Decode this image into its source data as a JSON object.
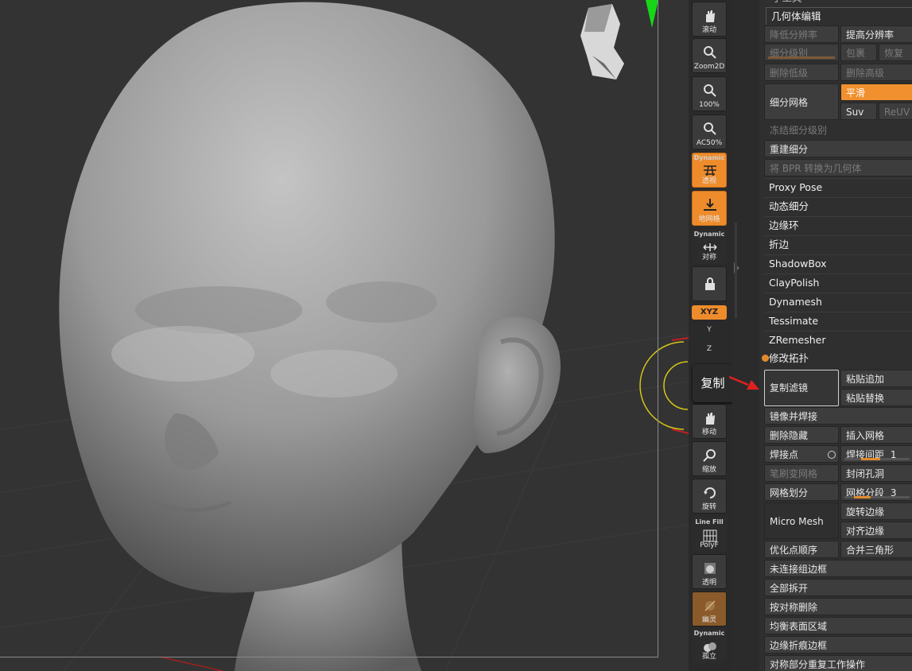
{
  "toolbar": {
    "scroll": "滚动",
    "zoom2d": "Zoom2D",
    "zoom100": "100%",
    "ac50": "AC50%",
    "persp_top": "Dynamic",
    "persp": "透视",
    "floor": "地网格",
    "sym_top": "Dynamic",
    "sym": "对称",
    "xyz": "XYZ",
    "y_glyph": "Y",
    "z_glyph": "Z",
    "move": "移动",
    "scale": "缩放",
    "rotate": "旋转",
    "linefill_top": "Line Fill",
    "polyf": "PolyF",
    "transp": "透明",
    "ghost": "幽灵",
    "solo_top": "Dynamic",
    "solo": "孤立"
  },
  "popup": {
    "label": "复制"
  },
  "panel": {
    "top_cut": "子工具",
    "geometry_title": "几何体编辑",
    "lower_res": "降低分辨率",
    "higher_res": "提高分辨率",
    "sdiv": "细分级别",
    "cage": "包裹",
    "restore": "恢复",
    "del_lower": "删除低级",
    "del_higher": "删除高级",
    "divide": "细分网格",
    "smooth": "平滑",
    "suv": "Suv",
    "reuv": "ReUV",
    "freeze": "冻结细分级别",
    "reconstruct": "重建细分",
    "bpr": "将 BPR 转换为几何体",
    "proxy": "Proxy Pose",
    "dynamic_sub": "动态细分",
    "edgeloop": "边缘环",
    "crease": "折边",
    "shadowbox": "ShadowBox",
    "claypolish": "ClayPolish",
    "dynamesh": "Dynamesh",
    "tessimate": "Tessimate",
    "zremesher": "ZRemesher",
    "modify_topo": "修改拓扑",
    "copy_filter": "复制滤镜",
    "paste_append": "粘贴追加",
    "paste_replace": "粘贴替换",
    "mirror_weld": "镜像并焊接",
    "del_hidden": "删除隐藏",
    "insert_mesh": "插入网格",
    "weld_points": "焊接点",
    "weld_dist": "焊接间距",
    "weld_dist_val": "1",
    "brush_mesh": "笔刷变网格",
    "close_holes": "封闭孔洞",
    "grid_divide": "网格划分",
    "mesh_segments": "网格分段",
    "mesh_segments_val": "3",
    "micro_mesh": "Micro Mesh",
    "spin_edge": "旋转边缘",
    "align_edge": "对齐边缘",
    "opt_points": "优化点顺序",
    "merge_tri": "合并三角形",
    "unweld_groups": "未连接组边框",
    "unweld_all": "全部拆开",
    "del_by_sym": "按对称删除",
    "equalize": "均衡表面区域",
    "edge_creases": "边缘折痕边框",
    "sym_copy": "对称部分重复工作操作"
  }
}
